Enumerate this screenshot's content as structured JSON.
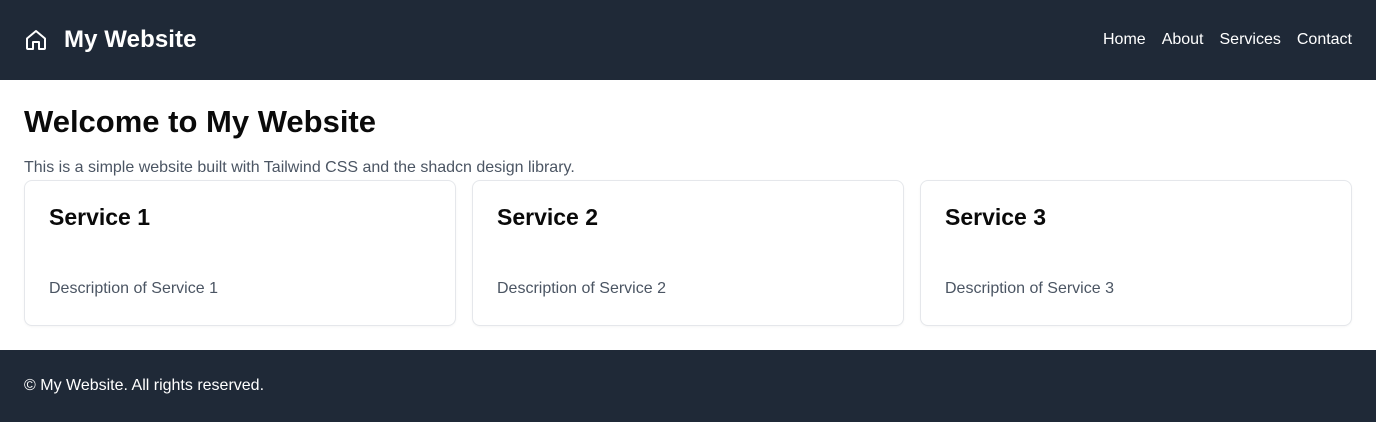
{
  "header": {
    "icon": "home-icon",
    "title": "My Website",
    "nav": [
      {
        "label": "Home"
      },
      {
        "label": "About"
      },
      {
        "label": "Services"
      },
      {
        "label": "Contact"
      }
    ]
  },
  "main": {
    "title": "Welcome to My Website",
    "intro": "This is a simple website built with Tailwind CSS and the shadcn design library.",
    "cards": [
      {
        "title": "Service 1",
        "description": "Description of Service 1"
      },
      {
        "title": "Service 2",
        "description": "Description of Service 2"
      },
      {
        "title": "Service 3",
        "description": "Description of Service 3"
      }
    ]
  },
  "footer": {
    "text": "© My Website. All rights reserved."
  },
  "colors": {
    "header_bg": "#1f2937",
    "footer_bg": "#1f2937",
    "muted_text": "#4b5563",
    "card_border": "#e5e7eb"
  }
}
